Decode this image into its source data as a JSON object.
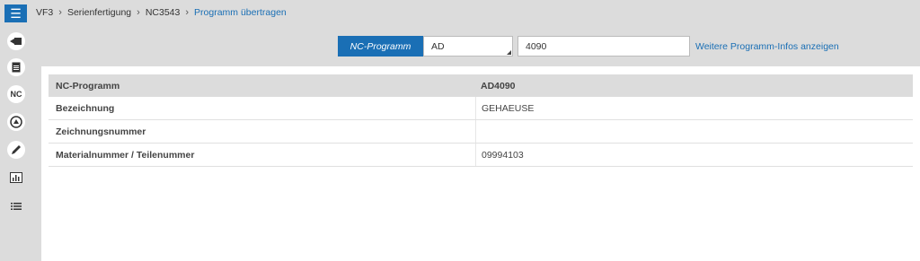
{
  "breadcrumb": [
    "VF3",
    "Serienfertigung",
    "NC3543",
    "Programm übertragen"
  ],
  "search": {
    "label": "NC-Programm",
    "prefix_value": "AD",
    "number_value": "4090",
    "more_link": "Weitere Programm-Infos anzeigen"
  },
  "sidebar": {
    "nc_label": "NC",
    "icons": [
      "transfer-icon",
      "document-icon",
      "nc-icon",
      "upload-circle-icon",
      "pen-icon",
      "bar-chart-icon",
      "list-icon"
    ]
  },
  "table": {
    "header": {
      "key": "NC-Programm",
      "value": "AD4090"
    },
    "rows": [
      {
        "key": "Bezeichnung",
        "value": "GEHAEUSE"
      },
      {
        "key": "Zeichnungsnummer",
        "value": ""
      },
      {
        "key": "Materialnummer / Teilenummer",
        "value": "09994103"
      }
    ]
  },
  "colors": {
    "accent": "#1a6fb5",
    "background": "#dcdcdc"
  }
}
